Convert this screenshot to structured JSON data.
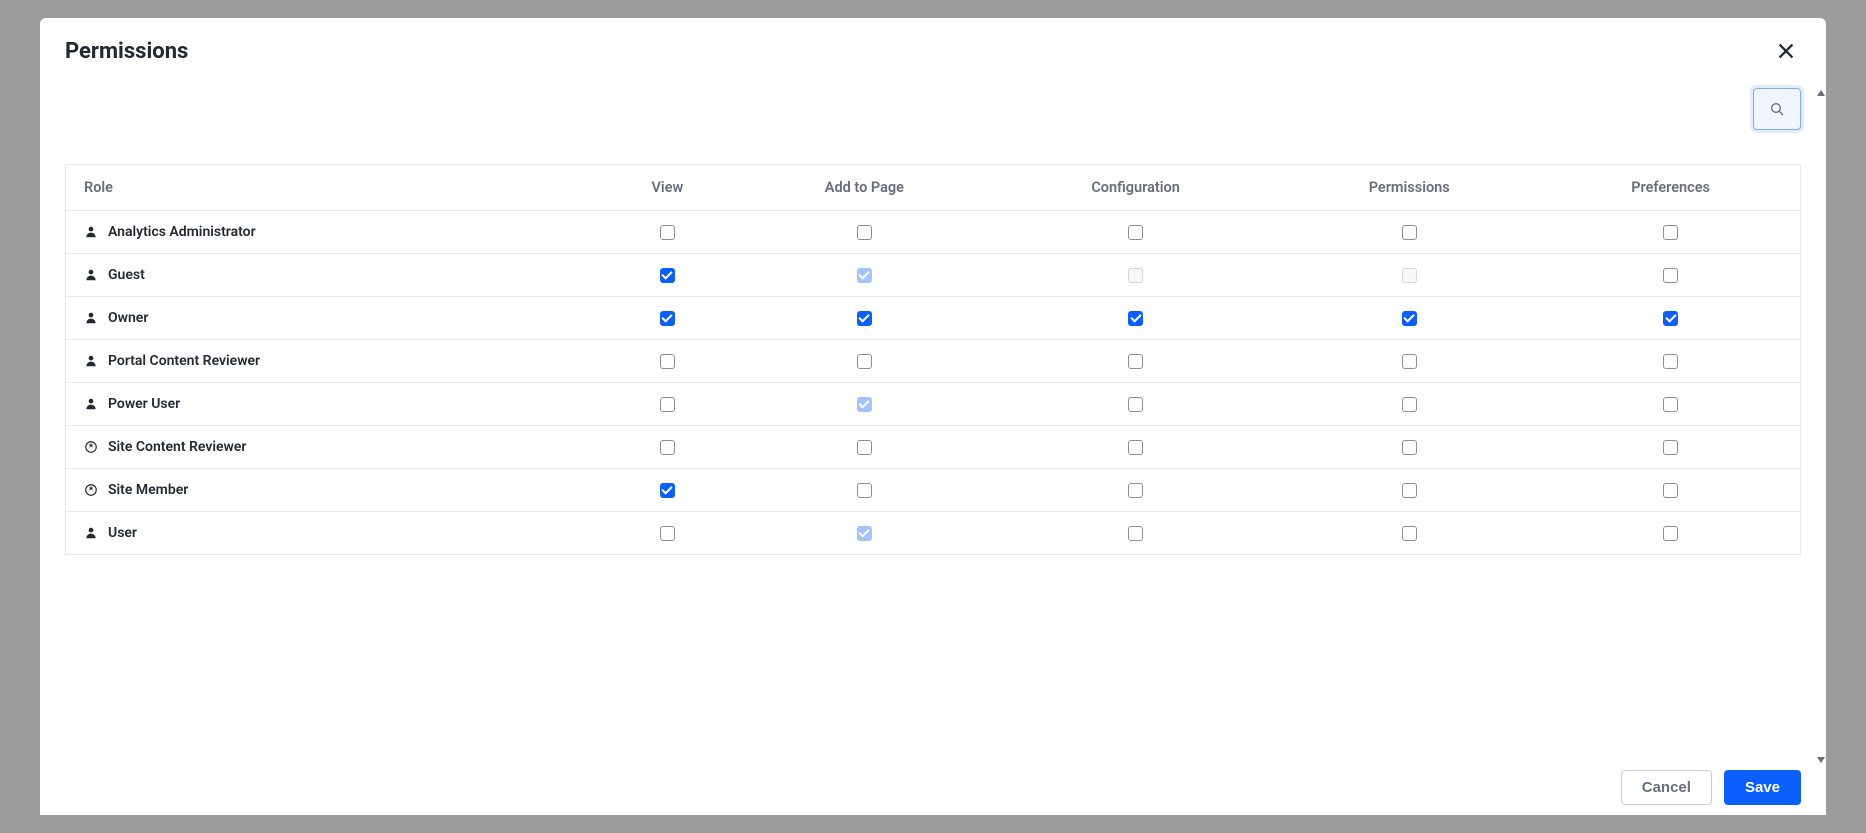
{
  "modal": {
    "title": "Permissions",
    "columns": [
      "Role",
      "View",
      "Add to Page",
      "Configuration",
      "Permissions",
      "Preferences"
    ],
    "roles": [
      {
        "name": "Analytics Administrator",
        "icon": "user",
        "perms": [
          {
            "checked": false,
            "disabled": false
          },
          {
            "checked": false,
            "disabled": false
          },
          {
            "checked": false,
            "disabled": false
          },
          {
            "checked": false,
            "disabled": false
          },
          {
            "checked": false,
            "disabled": false
          }
        ]
      },
      {
        "name": "Guest",
        "icon": "user",
        "perms": [
          {
            "checked": true,
            "disabled": false
          },
          {
            "checked": true,
            "disabled": true
          },
          {
            "checked": false,
            "disabled": true
          },
          {
            "checked": false,
            "disabled": true
          },
          {
            "checked": false,
            "disabled": false
          }
        ]
      },
      {
        "name": "Owner",
        "icon": "user",
        "perms": [
          {
            "checked": true,
            "disabled": false
          },
          {
            "checked": true,
            "disabled": false
          },
          {
            "checked": true,
            "disabled": false
          },
          {
            "checked": true,
            "disabled": false
          },
          {
            "checked": true,
            "disabled": false
          }
        ]
      },
      {
        "name": "Portal Content Reviewer",
        "icon": "user",
        "perms": [
          {
            "checked": false,
            "disabled": false
          },
          {
            "checked": false,
            "disabled": false
          },
          {
            "checked": false,
            "disabled": false
          },
          {
            "checked": false,
            "disabled": false
          },
          {
            "checked": false,
            "disabled": false
          }
        ]
      },
      {
        "name": "Power User",
        "icon": "user",
        "perms": [
          {
            "checked": false,
            "disabled": false
          },
          {
            "checked": true,
            "disabled": true
          },
          {
            "checked": false,
            "disabled": false
          },
          {
            "checked": false,
            "disabled": false
          },
          {
            "checked": false,
            "disabled": false
          }
        ]
      },
      {
        "name": "Site Content Reviewer",
        "icon": "site",
        "perms": [
          {
            "checked": false,
            "disabled": false
          },
          {
            "checked": false,
            "disabled": false
          },
          {
            "checked": false,
            "disabled": false
          },
          {
            "checked": false,
            "disabled": false
          },
          {
            "checked": false,
            "disabled": false
          }
        ]
      },
      {
        "name": "Site Member",
        "icon": "site",
        "perms": [
          {
            "checked": true,
            "disabled": false
          },
          {
            "checked": false,
            "disabled": false
          },
          {
            "checked": false,
            "disabled": false
          },
          {
            "checked": false,
            "disabled": false
          },
          {
            "checked": false,
            "disabled": false
          }
        ]
      },
      {
        "name": "User",
        "icon": "user",
        "perms": [
          {
            "checked": false,
            "disabled": false
          },
          {
            "checked": true,
            "disabled": true
          },
          {
            "checked": false,
            "disabled": false
          },
          {
            "checked": false,
            "disabled": false
          },
          {
            "checked": false,
            "disabled": false
          }
        ]
      }
    ],
    "footer": {
      "cancel": "Cancel",
      "save": "Save"
    }
  }
}
